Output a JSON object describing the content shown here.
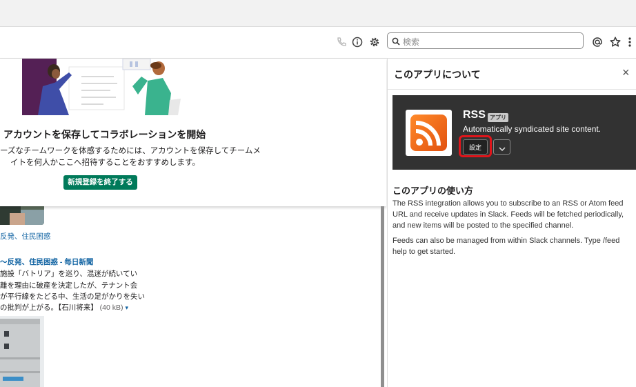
{
  "toolbar": {
    "search_placeholder": "検索",
    "icons": [
      "phone-icon",
      "info-icon",
      "gear-icon",
      "search-icon",
      "mention-icon",
      "star-icon",
      "kebab-menu-icon"
    ]
  },
  "right_panel": {
    "title": "このアプリについて",
    "close": "×",
    "app": {
      "name": "RSS",
      "badge": "アプリ",
      "description": "Automatically syndicated site content.",
      "settings_label": "設定"
    },
    "howto_title": "このアプリの使い方",
    "howto_p1": "The RSS integration allows you to subscribe to an RSS or Atom feed URL and receive updates in Slack. Feeds will be fetched periodically, and new items will be posted to the specified channel.",
    "howto_p2": "Feeds can also be managed from within Slack channels. Type /feed help to get started."
  },
  "promo": {
    "title": "アカウントを保存してコラボレーションを開始",
    "line1": "ーズなチームワークを体感するためには、アカウントを保存してチームメ",
    "line2": "イトを何人かここへ招待することをおすすめします。",
    "button": "新規登録を終了する"
  },
  "feed": {
    "tag1": "反発、住民困惑",
    "headline": "～反発、住民困惑 - 毎日新聞",
    "lines": [
      "施設「バトリア」を巡り、混迷が続いてい",
      "離を理由に破産を決定したが、テナント会",
      "が平行線をたどる中、生活の足がかりを失い",
      "の批判が上がる。【石川将来】"
    ],
    "file_size": "(40 kB)",
    "caret": "▾"
  },
  "colors": {
    "accent_green": "#007a5a",
    "link_blue": "#1264a3",
    "highlight_red": "#e0151b",
    "card_bg": "#323232",
    "rss_orange": "#f26522"
  }
}
